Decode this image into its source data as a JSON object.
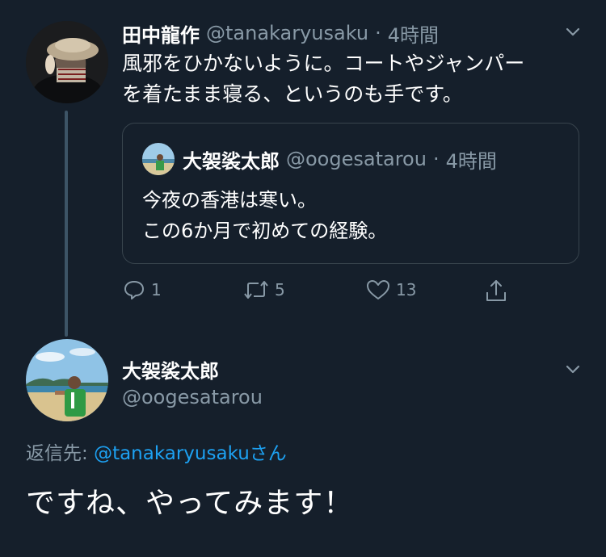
{
  "parent_tweet": {
    "display_name": "田中龍作",
    "handle": "@tanakaryusaku",
    "separator": "·",
    "time": "4時間",
    "lines": [
      "風邪をひかないように。コートやジャンパー",
      "を着たまま寝る、というのも手です。"
    ]
  },
  "quoted_tweet": {
    "display_name": "大袈裟太郎",
    "handle": "@oogesatarou",
    "separator": "·",
    "time": "4時間",
    "lines": [
      "今夜の香港は寒い。",
      "この6か月で初めての経験。"
    ]
  },
  "actions": {
    "reply_count": "1",
    "retweet_count": "5",
    "like_count": "13"
  },
  "reply_tweet": {
    "display_name": "大袈裟太郎",
    "handle": "@oogesatarou",
    "replying_to_label": "返信先:",
    "replying_to_handle": "@tanakaryusaku",
    "replying_to_suffix": "さん",
    "text": "ですね、やってみます！"
  },
  "icons": {
    "chevron": "chevron-down-icon",
    "reply": "reply-icon",
    "retweet": "retweet-icon",
    "like": "heart-icon",
    "share": "share-icon"
  },
  "colors": {
    "background": "#151f2b",
    "muted": "#8899a6",
    "link": "#1da1f2",
    "border": "#38444d"
  }
}
